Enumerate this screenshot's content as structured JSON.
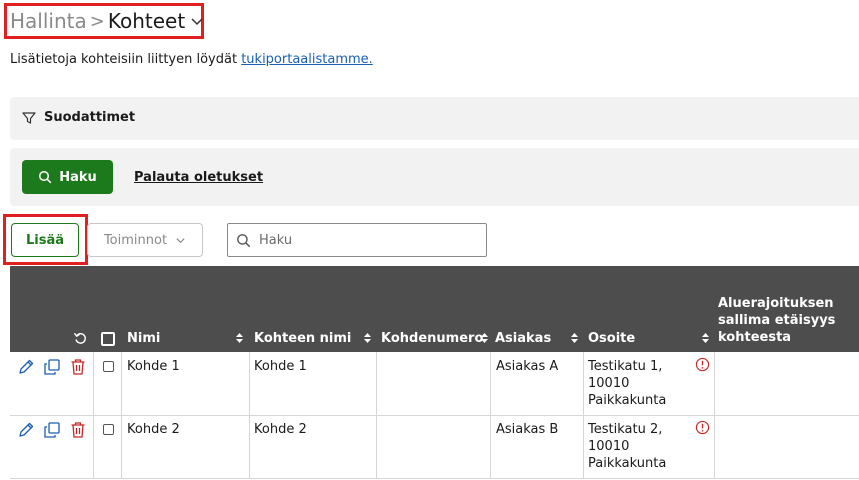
{
  "breadcrumb": {
    "parent": "Hallinta",
    "separator": ">",
    "current": "Kohteet"
  },
  "info": {
    "text": "Lisätietoja kohteisiin liittyen löydät ",
    "link": "tukiportaalistamme."
  },
  "filters": {
    "label": "Suodattimet"
  },
  "search_panel": {
    "search_button": "Haku",
    "reset_link": "Palauta oletukset"
  },
  "toolbar": {
    "add_button": "Lisää",
    "actions_dropdown": "Toiminnot",
    "search_placeholder": "Haku"
  },
  "table": {
    "headers": {
      "name": "Nimi",
      "target_name": "Kohteen nimi",
      "target_number": "Kohdenumero",
      "customer": "Asiakas",
      "address": "Osoite",
      "distance_line1": "Aluerajoituksen",
      "distance_line2": "sallima etäisyys",
      "distance_line3": "kohteesta"
    },
    "rows": [
      {
        "name": "Kohde 1",
        "target_name": "Kohde 1",
        "target_number": "",
        "customer": "Asiakas A",
        "address_line1": "Testikatu 1,",
        "address_line2": "10010",
        "address_line3": "Paikkakunta",
        "distance": ""
      },
      {
        "name": "Kohde 2",
        "target_name": "Kohde 2",
        "target_number": "",
        "customer": "Asiakas B",
        "address_line1": "Testikatu 2,",
        "address_line2": "10010",
        "address_line3": "Paikkakunta",
        "distance": ""
      }
    ]
  },
  "colors": {
    "primary_green": "#1c7a1c",
    "link_blue": "#1a5fb4",
    "header_bg": "#4d4d4d",
    "highlight_red": "#e02020",
    "warning_red": "#c62828"
  }
}
